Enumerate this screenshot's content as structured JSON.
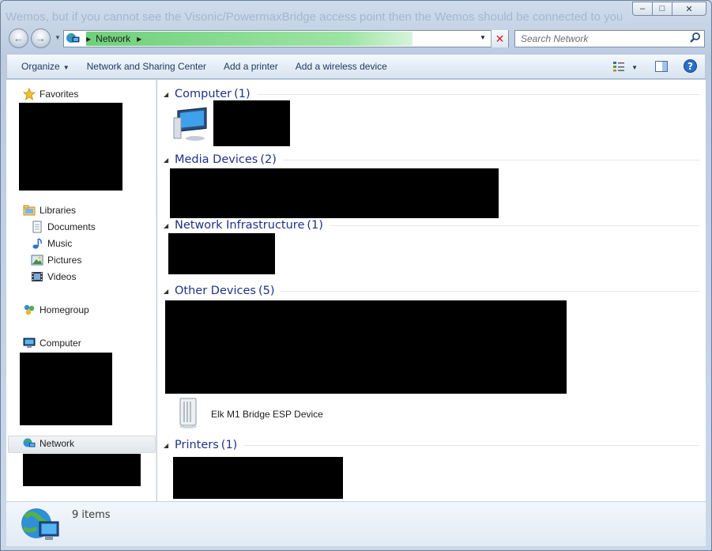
{
  "background_text": "Wemos, but if you cannot see the Visonic/PowermaxBridge access point then the Wemos should be connected to your WiFi",
  "window": {
    "controls": {
      "minimize": "–",
      "maximize": "□",
      "close": "✕"
    }
  },
  "address_bar": {
    "icon": "network-icon",
    "crumbs": [
      "Network"
    ],
    "progress": 0.83,
    "progress_color": "#6fd07a"
  },
  "search": {
    "placeholder": "Search Network",
    "value": ""
  },
  "toolbar": {
    "organize": "Organize",
    "network_sharing": "Network and Sharing Center",
    "add_printer": "Add a printer",
    "add_wireless": "Add a wireless device"
  },
  "nav": {
    "favorites": "Favorites",
    "libraries": "Libraries",
    "documents": "Documents",
    "music": "Music",
    "pictures": "Pictures",
    "videos": "Videos",
    "homegroup": "Homegroup",
    "computer": "Computer",
    "network": "Network"
  },
  "groups": [
    {
      "title": "Computer",
      "count": "(1)"
    },
    {
      "title": "Media Devices",
      "count": "(2)"
    },
    {
      "title": "Network Infrastructure",
      "count": "(1)"
    },
    {
      "title": "Other Devices",
      "count": "(5)"
    },
    {
      "title": "Printers",
      "count": "(1)"
    }
  ],
  "items": {
    "elk_device": "Elk M1 Bridge ESP Device"
  },
  "status": {
    "count": "9 items"
  },
  "colors": {
    "accent": "#1e3287",
    "selection": "#e2e6eb",
    "redaction": "#000000"
  }
}
